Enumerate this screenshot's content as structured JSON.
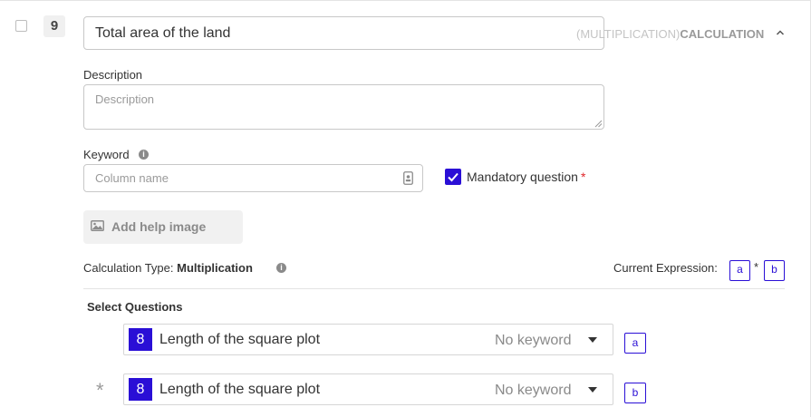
{
  "question": {
    "number": "9",
    "title": "Total area of the land",
    "type_sub": "(MULTIPLICATION)",
    "type_main": "CALCULATION"
  },
  "description": {
    "label": "Description",
    "placeholder": "Description"
  },
  "keyword": {
    "label": "Keyword",
    "placeholder": "Column name"
  },
  "mandatory": {
    "label": "Mandatory question",
    "required_mark": "*",
    "checked": true
  },
  "help_image": {
    "label": "Add help image"
  },
  "calculation": {
    "type_label": "Calculation Type:",
    "type_value": "Multiplication",
    "expression_label": "Current Expression:",
    "expression_tokens": [
      "a",
      "*",
      "b"
    ]
  },
  "select_questions": {
    "label": "Select Questions",
    "rows": [
      {
        "operator": "",
        "number": "8",
        "title": "Length of the square plot",
        "keyword": "No keyword",
        "slot": "a"
      },
      {
        "operator": "*",
        "number": "8",
        "title": "Length of the square plot",
        "keyword": "No keyword",
        "slot": "b"
      }
    ]
  },
  "colors": {
    "accent": "#2a0fd6",
    "required": "#e0272b",
    "muted": "#9a9a9a",
    "border": "#c8c8c8"
  },
  "icons": [
    "chevron-up-icon",
    "info-icon",
    "id-card-icon",
    "image-icon",
    "caret-down-icon",
    "checkmark-icon"
  ]
}
